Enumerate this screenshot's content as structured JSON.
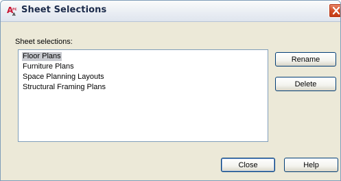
{
  "window": {
    "title": "Sheet Selections",
    "app_icon": "autocad-architecture-icon",
    "close_icon": "close-icon"
  },
  "label": {
    "sheet_selections": "Sheet selections:"
  },
  "list": {
    "items": [
      {
        "label": "Floor Plans",
        "selected": true
      },
      {
        "label": "Furniture Plans",
        "selected": false
      },
      {
        "label": "Space Planning Layouts",
        "selected": false
      },
      {
        "label": "Structural Framing Plans",
        "selected": false
      }
    ]
  },
  "buttons": {
    "rename": "Rename",
    "delete": "Delete",
    "close": "Close",
    "help": "Help"
  },
  "colors": {
    "selection_highlight": "#c7c9cf",
    "close_button": "#d14a22",
    "dialog_background": "#ece9d8"
  }
}
